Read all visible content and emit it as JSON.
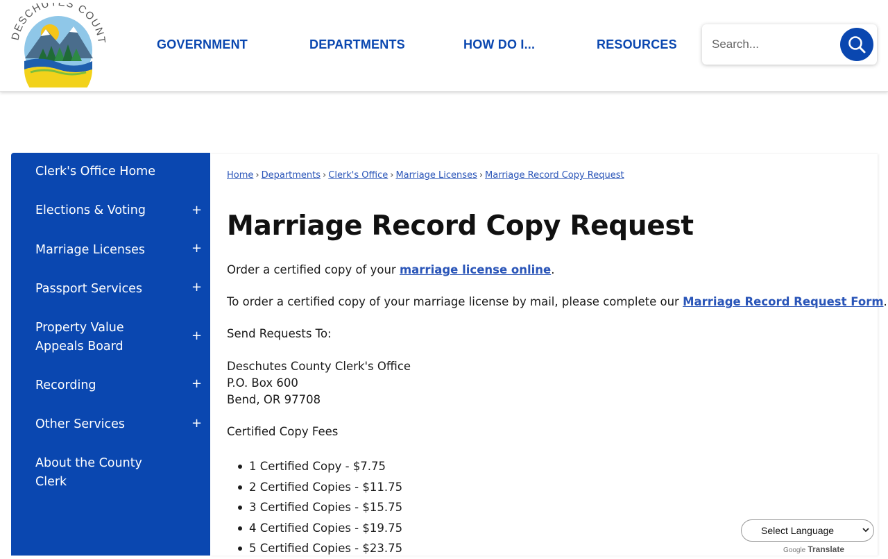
{
  "header": {
    "logo_text": "DESCHUTES COUNTY",
    "nav": [
      "GOVERNMENT",
      "DEPARTMENTS",
      "HOW DO I...",
      "RESOURCES"
    ],
    "search": {
      "placeholder": "Search..."
    }
  },
  "sidebar": {
    "items": [
      {
        "label": "Clerk's Office Home",
        "expandable": false
      },
      {
        "label": "Elections & Voting",
        "expandable": true
      },
      {
        "label": "Marriage Licenses",
        "expandable": true
      },
      {
        "label": "Passport Services",
        "expandable": true
      },
      {
        "label": "Property Value Appeals Board",
        "expandable": true
      },
      {
        "label": "Recording",
        "expandable": true
      },
      {
        "label": "Other Services",
        "expandable": true
      },
      {
        "label": "About the County Clerk",
        "expandable": false
      }
    ],
    "expand_symbol": "+"
  },
  "breadcrumb": {
    "items": [
      "Home",
      "Departments",
      "Clerk's Office",
      "Marriage Licenses",
      "Marriage Record Copy Request"
    ],
    "separator": "›"
  },
  "main": {
    "title": "Marriage Record Copy Request",
    "p1_before": "Order a certified copy of your ",
    "p1_link": "marriage license online",
    "p1_after": ".",
    "p2_before": "To order a certified copy of your marriage license by mail, please complete our ",
    "p2_link": "Marriage Record Request Form",
    "p2_after": ".",
    "send_heading": "Send Requests To:",
    "address": [
      "Deschutes County Clerk's Office",
      "P.O. Box 600",
      "Bend, OR 97708"
    ],
    "fees_heading": "Certified Copy Fees",
    "fees": [
      "1 Certified Copy - $7.75",
      "2 Certified Copies - $11.75",
      "3 Certified Copies - $15.75",
      "4 Certified Copies - $19.75",
      "5 Certified Copies - $23.75"
    ]
  },
  "translate": {
    "select_label": "Select Language",
    "powered_google": "Google",
    "powered_translate": "Translate"
  },
  "colors": {
    "brand_blue": "#0a47b0",
    "link_blue": "#2a55b8"
  }
}
